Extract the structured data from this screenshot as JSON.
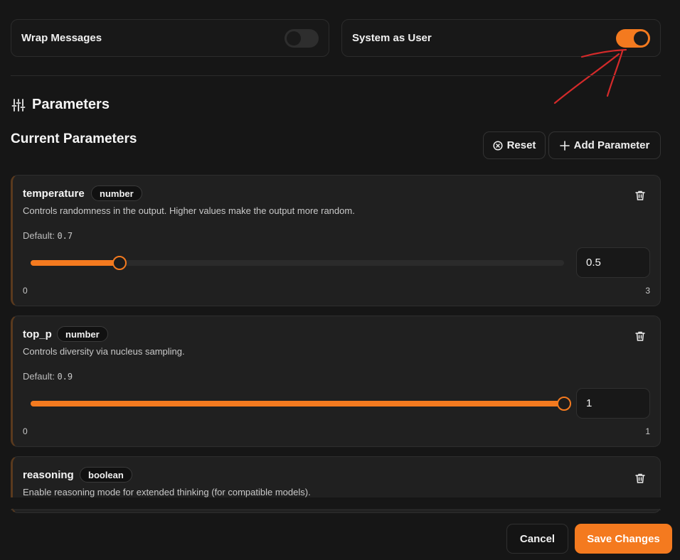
{
  "toggles": {
    "wrap_messages": {
      "label": "Wrap Messages",
      "on": false
    },
    "system_as_user": {
      "label": "System as User",
      "on": true
    }
  },
  "section": {
    "title": "Parameters",
    "icon": "sliders-icon"
  },
  "current": {
    "title": "Current Parameters",
    "reset_label": "Reset",
    "add_label": "Add Parameter"
  },
  "params": [
    {
      "name": "temperature",
      "type": "number",
      "description": "Controls randomness in the output. Higher values make the output more random.",
      "default_label": "Default:",
      "default_value": "0.7",
      "value": "0.5",
      "min": "0",
      "max": "3",
      "fraction": 0.1667
    },
    {
      "name": "top_p",
      "type": "number",
      "description": "Controls diversity via nucleus sampling.",
      "default_label": "Default:",
      "default_value": "0.9",
      "value": "1",
      "min": "0",
      "max": "1",
      "fraction": 1
    },
    {
      "name": "reasoning",
      "type": "boolean",
      "description": "Enable reasoning mode for extended thinking (for compatible models)."
    }
  ],
  "footer": {
    "cancel_label": "Cancel",
    "save_label": "Save Changes"
  },
  "colors": {
    "accent": "#f47a1f",
    "annotation": "#d42a2a"
  }
}
